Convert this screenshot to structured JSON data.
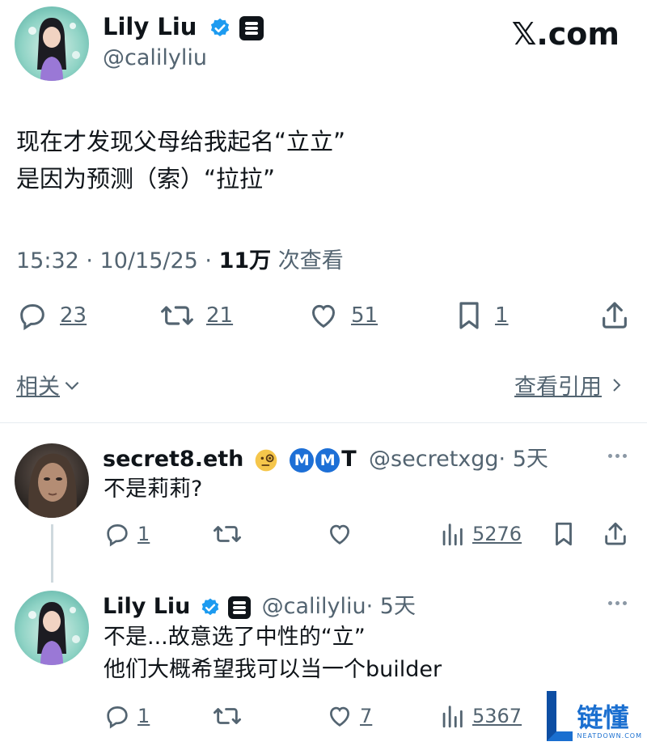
{
  "header": {
    "author_name": "Lily Liu",
    "author_handle": "@calilyliu",
    "site_logo": "𝕏.com"
  },
  "tweet": {
    "lines": [
      "现在才发现父母给我起名“立立”",
      "是因为预测（索）“拉拉”"
    ],
    "time": "15:32 · 10/15/25 · ",
    "views_count": "11万",
    "views_label": " 次查看",
    "actions": {
      "replies": "23",
      "retweets": "21",
      "likes": "51",
      "bookmarks": "1"
    }
  },
  "links": {
    "related": "相关",
    "view_quotes": "查看引用"
  },
  "replies": [
    {
      "name": "secret8.eth",
      "badge_letters": [
        "M",
        "M"
      ],
      "extra_letter": "T",
      "handle": "@secretxgg",
      "time": "· 5天",
      "text": [
        "不是莉莉?"
      ],
      "actions": {
        "replies": "1",
        "likes": "",
        "views": "5276"
      }
    },
    {
      "name": "Lily Liu",
      "handle": "@calilyliu",
      "time": "· 5天",
      "text": [
        "不是...故意选了中性的“立”",
        "他们大概希望我可以当一个builder"
      ],
      "actions": {
        "replies": "1",
        "likes": "7",
        "views": "5367"
      }
    }
  ],
  "watermark": {
    "text": "链懂",
    "sub": "NEATDOWN.COM"
  },
  "colors": {
    "text": "#0f1419",
    "muted": "#536471",
    "verified": "#1d9bf0"
  }
}
